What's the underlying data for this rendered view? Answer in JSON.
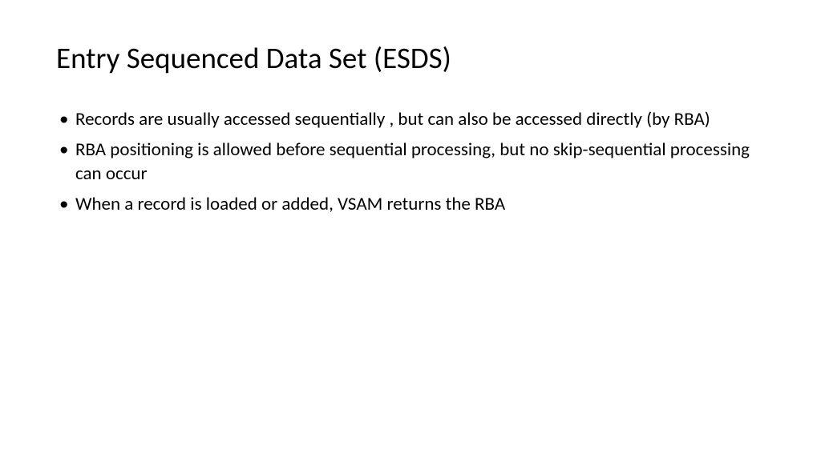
{
  "slide": {
    "title": "Entry Sequenced Data Set (ESDS)",
    "bullets": [
      "Records are usually accessed sequentially , but can also be accessed directly (by RBA)",
      "RBA positioning is allowed before sequential processing, but no skip-sequential processing can occur",
      "When a record is loaded or added, VSAM returns the RBA"
    ]
  }
}
